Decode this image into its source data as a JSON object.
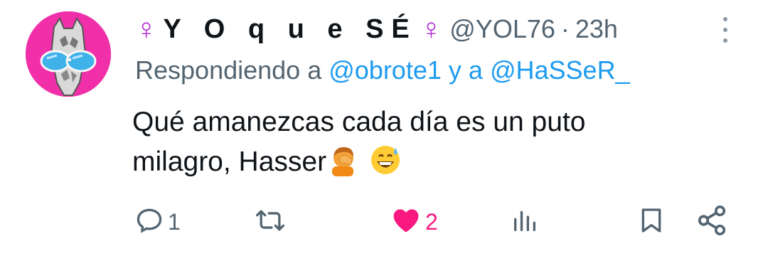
{
  "tweet": {
    "author": {
      "display_name": "Y O q u e SÉ",
      "name_emoji_left": "♀",
      "name_emoji_right": "♀",
      "handle": "@YOL76",
      "separator": "·",
      "time": "23h",
      "avatar_icon": "giraffe-with-sunglasses-avatar"
    },
    "replying": {
      "prefix": "Respondiendo a",
      "mention_1": "@obrote1",
      "connector": "y a",
      "mention_2": "@HaSSeR_"
    },
    "text_line_1": "Qué amanezcas cada día es un puto",
    "text_line_2": "milagro, Hasser",
    "text_emojis": [
      "facepalm-emoji",
      "grinning-sweat-emoji"
    ],
    "actions": {
      "reply": {
        "icon": "reply-icon",
        "count": "1"
      },
      "retweet": {
        "icon": "retweet-icon",
        "count": ""
      },
      "like": {
        "icon": "heart-filled-icon",
        "count": "2",
        "liked": true
      },
      "views": {
        "icon": "views-icon",
        "count": ""
      },
      "bookmark": {
        "icon": "bookmark-icon"
      },
      "share": {
        "icon": "share-icon"
      }
    },
    "more_icon": "more-vertical-icon"
  },
  "colors": {
    "text": "#0f1419",
    "secondary": "#536471",
    "link": "#1d9bf0",
    "like": "#f91880",
    "avatar_bg": "#f02fa8",
    "venus": "#b230d4"
  }
}
